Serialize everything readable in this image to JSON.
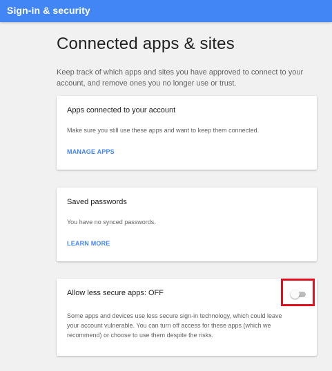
{
  "header": {
    "title": "Sign-in & security"
  },
  "main": {
    "title": "Connected apps & sites",
    "intro": "Keep track of which apps and sites you have approved to connect to your account, and remove ones you no longer use or trust."
  },
  "cards": [
    {
      "title": "Apps connected to your account",
      "description": "Make sure you still use these apps and want to keep them connected.",
      "link": "MANAGE APPS"
    },
    {
      "title": "Saved passwords",
      "description": "You have no synced passwords.",
      "link": "LEARN MORE"
    },
    {
      "title": "Allow less secure apps: OFF",
      "description": "Some apps and devices use less secure sign-in technology, which could leave your account vulnerable. You can turn off access for these apps (which we recommend) or choose to use them despite the risks.",
      "toggle_state": "off"
    }
  ],
  "colors": {
    "header": "#4285f4",
    "link": "#4285f4",
    "highlight": "#e2101e"
  }
}
